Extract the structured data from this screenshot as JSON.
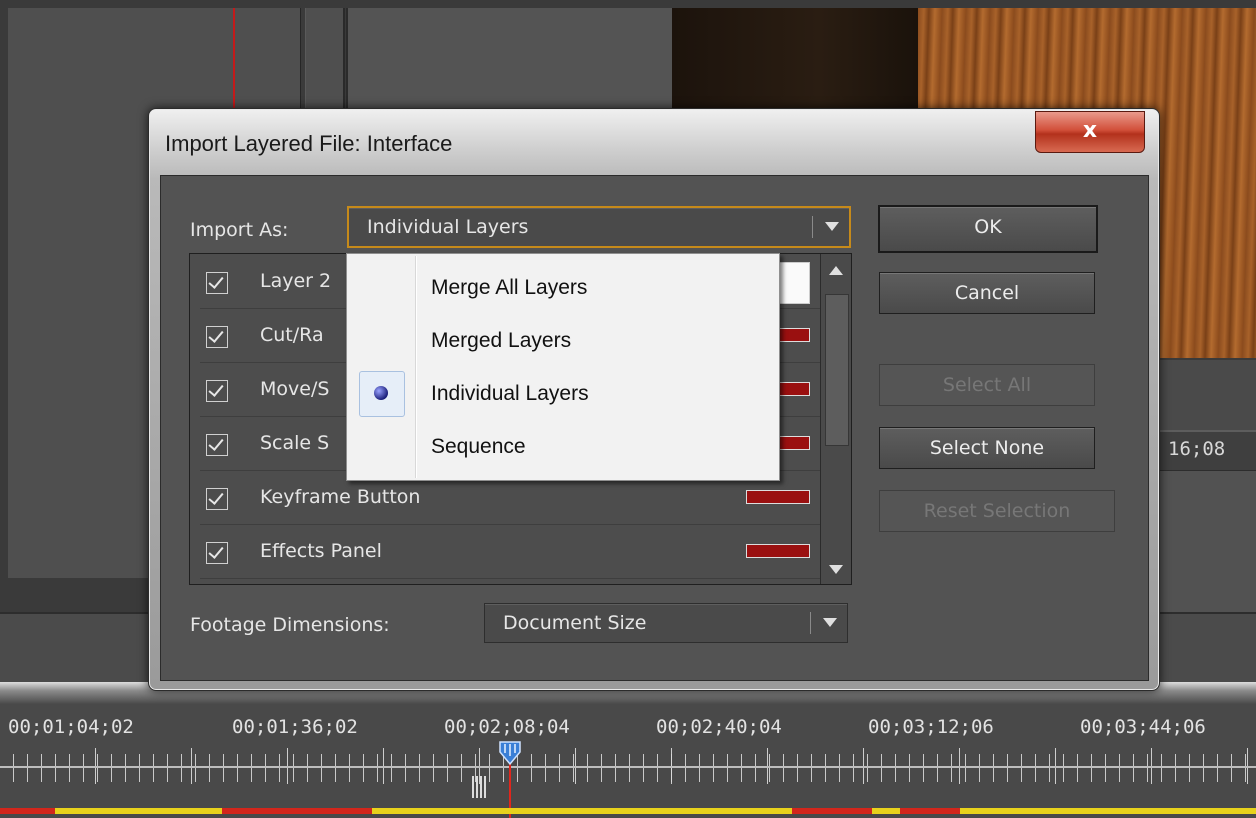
{
  "background": {
    "program_timecode": "16;08"
  },
  "timeline": {
    "timecodes": [
      "00;01;04;02",
      "00;01;36;02",
      "00;02;08;04",
      "00;02;40;04",
      "00;03;12;06",
      "00;03;44;06"
    ]
  },
  "dialog": {
    "title": "Import Layered File: Interface",
    "close_label": "x",
    "import_as_label": "Import As:",
    "import_as_value": "Individual Layers",
    "footage_label": "Footage Dimensions:",
    "footage_value": "Document Size",
    "layers": [
      {
        "name": "Layer 2"
      },
      {
        "name": "Cut/Ra"
      },
      {
        "name": "Move/S"
      },
      {
        "name": "Scale S"
      },
      {
        "name": "Keyframe Button"
      },
      {
        "name": "Effects Panel"
      }
    ],
    "buttons": {
      "ok": "OK",
      "cancel": "Cancel",
      "select_all": "Select All",
      "select_none": "Select None",
      "reset_selection": "Reset Selection"
    },
    "menu": {
      "items": [
        "Merge All Layers",
        "Merged Layers",
        "Individual Layers",
        "Sequence"
      ],
      "selected": "Individual Layers"
    }
  },
  "colors": {
    "accent_focus": "#c68a1a",
    "close_button": "#c7412b",
    "playhead": "#e0261c"
  }
}
